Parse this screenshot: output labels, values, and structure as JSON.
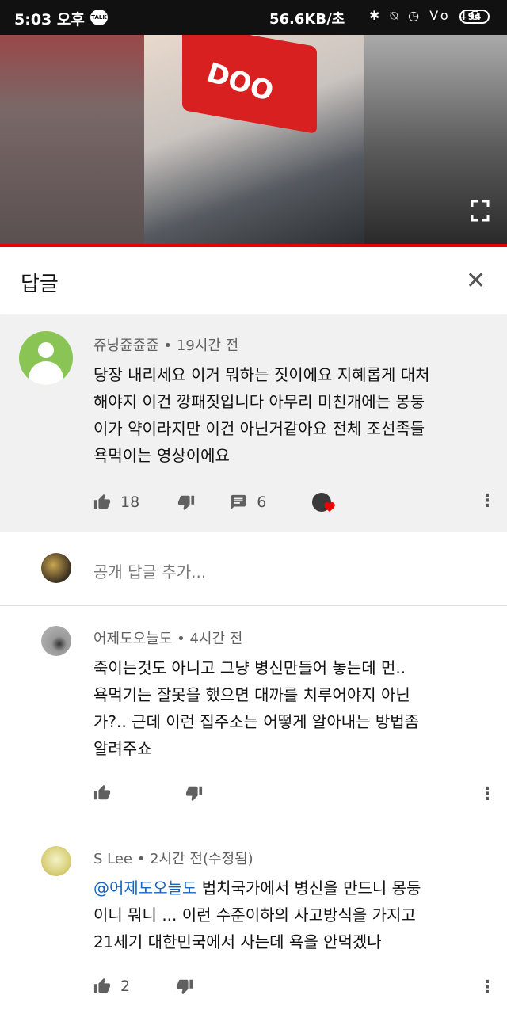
{
  "status_bar": {
    "time": "5:03 오후",
    "talk_badge": "TALK",
    "network": "56.6KB/초",
    "icons": "✱ ⍉ ◷ Vo 4G",
    "battery": "94"
  },
  "video": {
    "bag_text": "DOO"
  },
  "header": {
    "title": "답글",
    "close_symbol": "✕"
  },
  "parent_comment": {
    "author": "쥬닝쥰쥰쥰",
    "time": "19시간 전",
    "text": "당장 내리세요 이거 뭐하는 짓이에요 지혜롭게 대처\n해야지 이건 깡패짓입니다 아무리 미친개에는 몽둥\n이가 약이라지만 이건 아닌거같아요 전체 조선족들\n욕먹이는 영상이에요",
    "likes": "18",
    "replies": "6"
  },
  "reply_input": {
    "placeholder": "공개 답글 추가..."
  },
  "replies": [
    {
      "author": "어제도오늘도",
      "time": "4시간 전",
      "text": "죽이는것도 아니고 그냥 병신만들어 놓는데 먼..\n욕먹기는  잘못을 했으면 대까를 치루어야지 아닌\n가?.. 근데 이런 집주소는 어떻게 알아내는 방법좀\n알려주쇼",
      "likes": ""
    },
    {
      "author": "S Lee",
      "time": "2시간 전(수정됨)",
      "mention": "@어제도오늘도",
      "text": "  법치국가에서 병신을 만드니 몽둥\n이니 뭐니  ... 이런 수준이하의 사고방식을 가지고\n21세기 대한민국에서 사는데 욕을 안먹겠나",
      "likes": "2"
    }
  ],
  "colors": {
    "accent_red": "#ee0000",
    "link_blue": "#1565c0",
    "avatar_green": "#8ac454"
  }
}
